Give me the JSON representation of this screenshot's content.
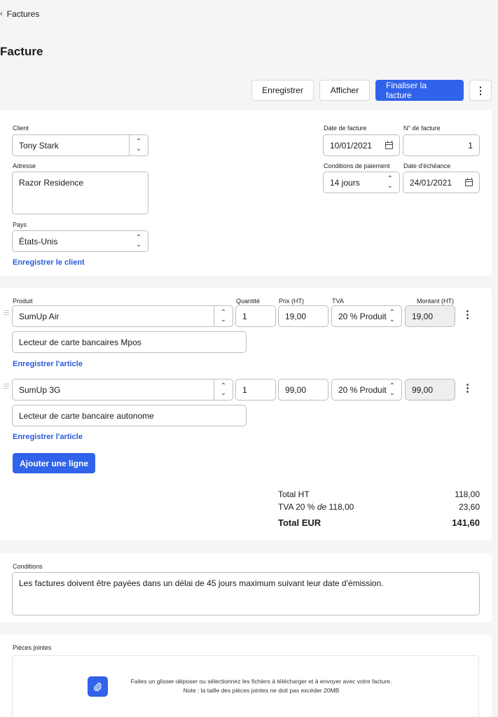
{
  "nav": {
    "back_label": "Factures"
  },
  "page": {
    "title": "Facture"
  },
  "toolbar": {
    "save": "Enregistrer",
    "preview": "Afficher",
    "finalize": "Finaliser la facture",
    "more": "⋮"
  },
  "client_section": {
    "client_label": "Client",
    "client_value": "Tony Stark",
    "address_label": "Adresse",
    "address_value": "Razor Residence",
    "country_label": "Pays",
    "country_value": "États-Unis",
    "save_client": "Enregistrer le client",
    "invoice_date_label": "Date de facture",
    "invoice_date_value": "10/01/2021",
    "invoice_number_label": "N° de facture",
    "invoice_number_value": "1",
    "payment_terms_label": "Conditions de paiement",
    "payment_terms_value": "14 jours",
    "due_date_label": "Date d'échéance",
    "due_date_value": "24/01/2021"
  },
  "items": {
    "headers": {
      "product": "Produit",
      "quantity": "Quantité",
      "price": "Prix (HT)",
      "vat": "TVA",
      "amount": "Montant (HT)"
    },
    "rows": [
      {
        "product": "SumUp Air",
        "quantity": "1",
        "price": "19,00",
        "vat": "20 % Produit",
        "amount": "19,00",
        "description": "Lecteur de carte bancaires Mpos",
        "save_item": "Enregistrer l'article"
      },
      {
        "product": "SumUp 3G",
        "quantity": "1",
        "price": "99,00",
        "vat": "20 % Produit",
        "amount": "99,00",
        "description": "Lecteur de carte bancaire autonome",
        "save_item": "Enregistrer l'article"
      }
    ],
    "add_line": "Ajouter une ligne"
  },
  "totals": {
    "ht_label": "Total HT",
    "ht_value": "118,00",
    "vat_prefix": "TVA 20 % ",
    "vat_of": "de",
    "vat_base": " 118,00",
    "vat_value": "23,60",
    "total_label": "Total EUR",
    "total_value": "141,60"
  },
  "conditions": {
    "label": "Conditions",
    "text": "Les factures doivent être payées dans un délai de 45 jours maximum suivant leur date d'émission."
  },
  "attachments": {
    "label": "Pièces jointes",
    "line1": "Faites un glisser-déposer ou sélectionnez les fichiers à télécharger et à envoyer avec votre facture.",
    "line2": "Note : la taille des pièces jointes ne doit pas excéder 20MB"
  },
  "colors": {
    "primary": "#3063e9",
    "link": "#2a5bd7",
    "background": "#f5f5f5"
  }
}
